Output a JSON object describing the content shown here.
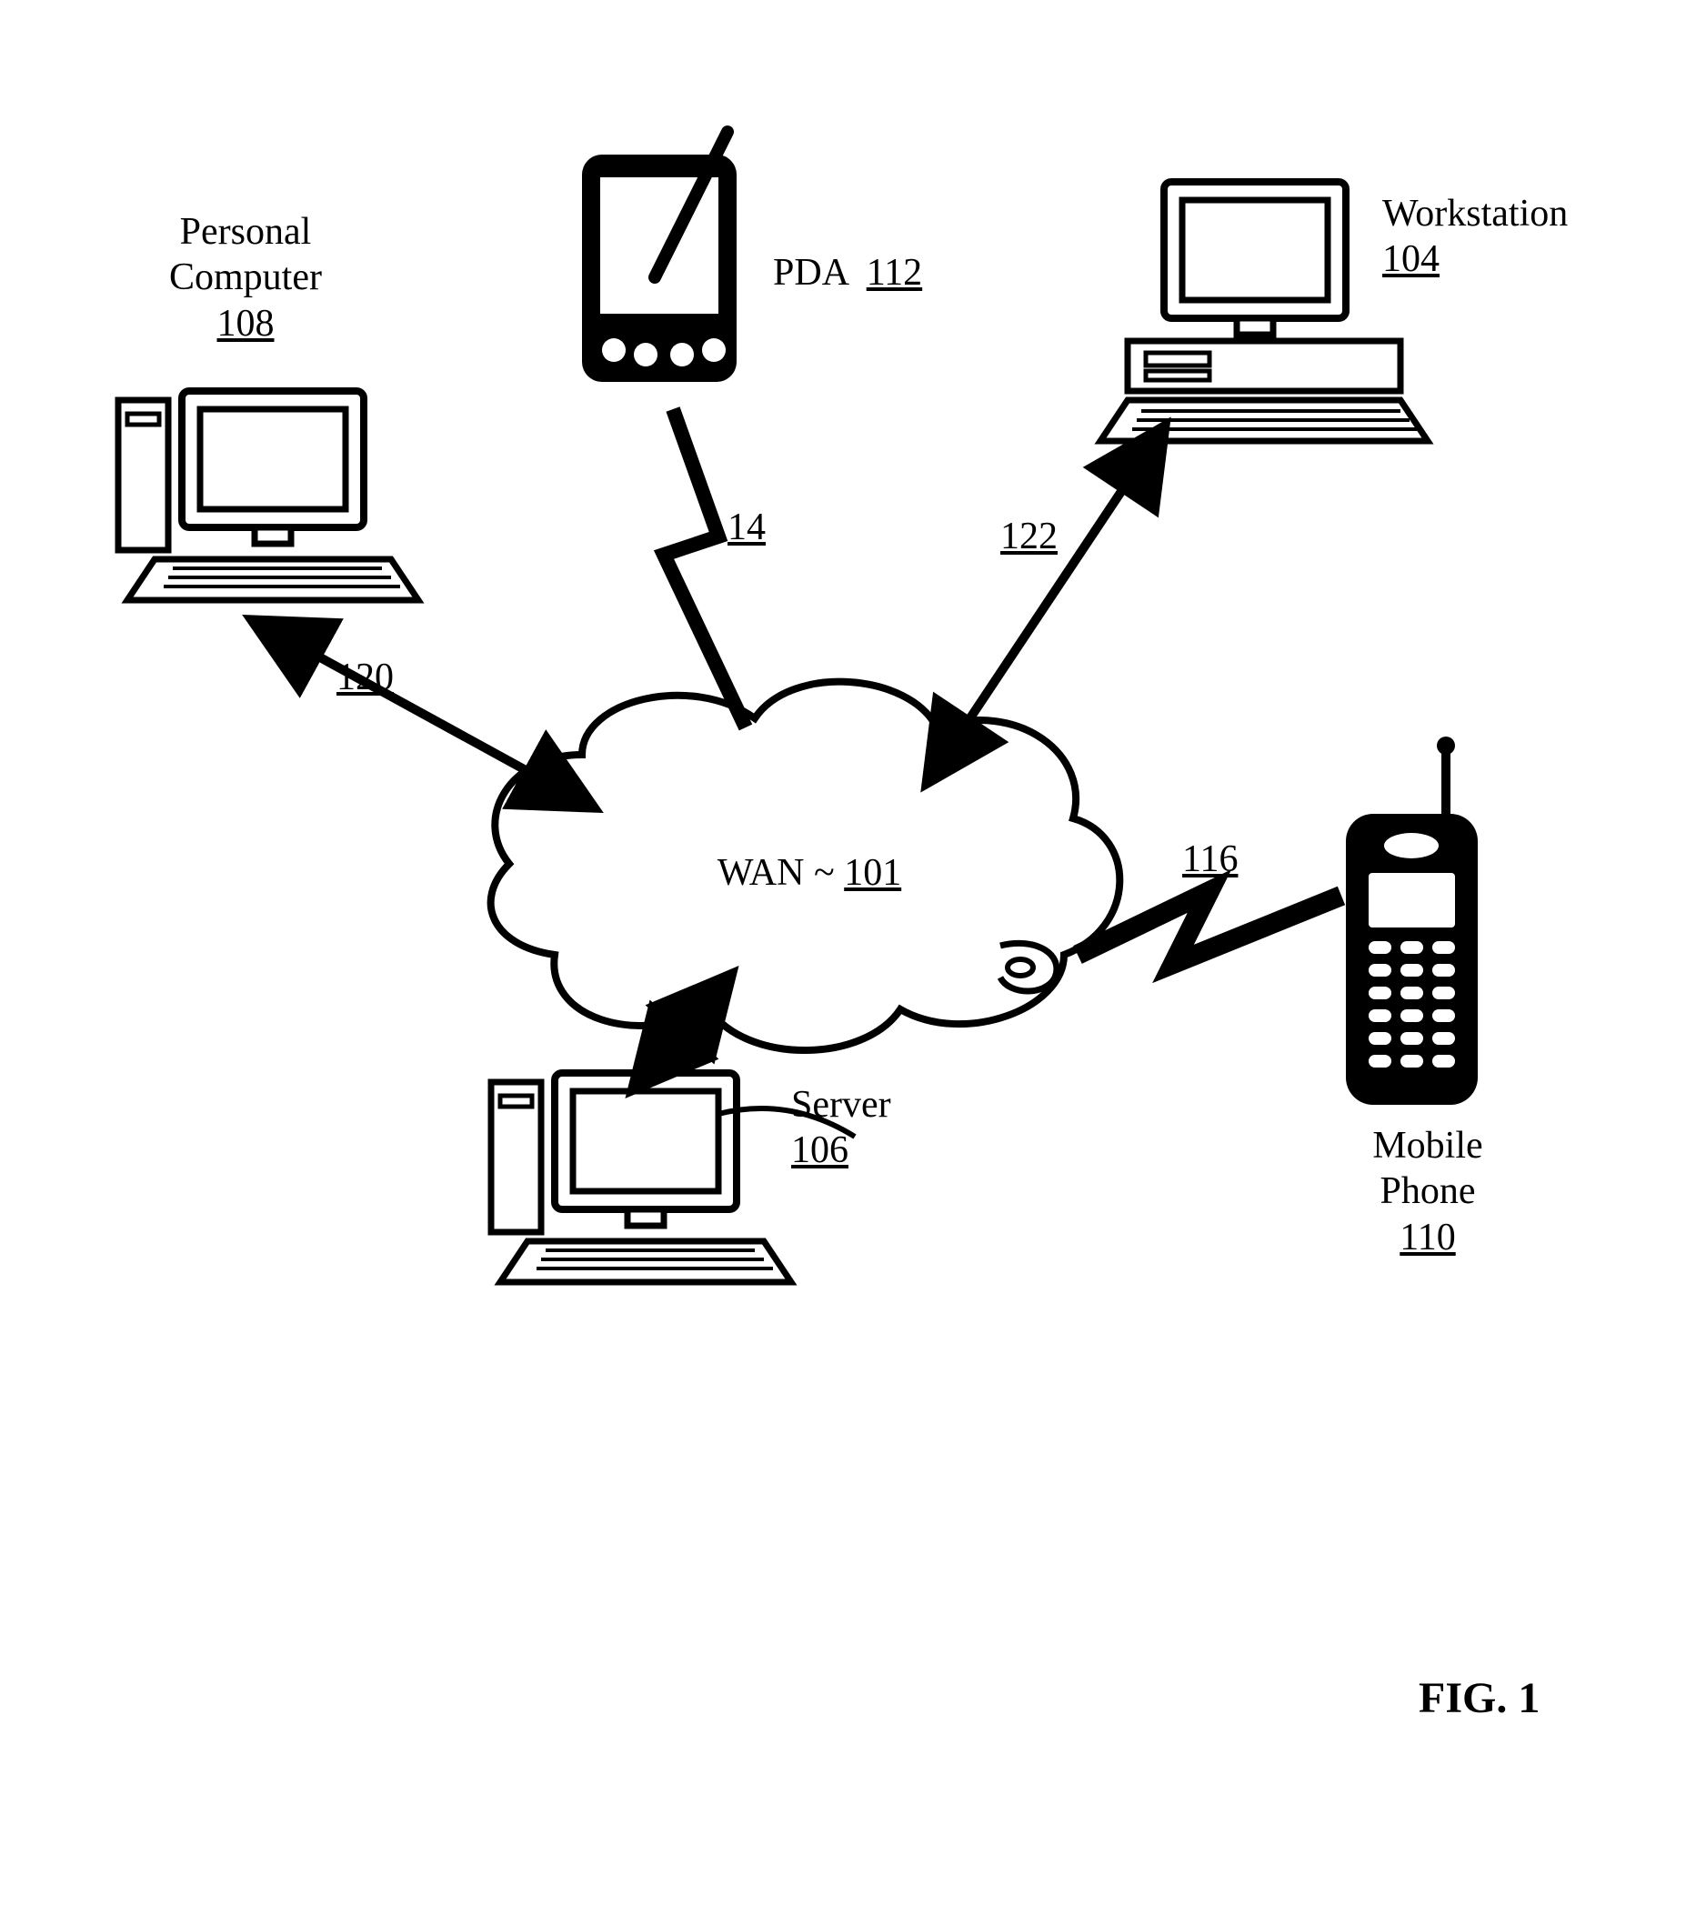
{
  "nodes": {
    "pc": {
      "label_line1": "Personal",
      "label_line2": "Computer",
      "ref": "108"
    },
    "pda": {
      "label": "PDA",
      "ref": "112"
    },
    "workstation": {
      "label": "Workstation",
      "ref": "104"
    },
    "wan": {
      "label_prefix": "WAN ~ ",
      "ref": "101"
    },
    "server": {
      "label": "Server",
      "ref": "106"
    },
    "mobile": {
      "label_line1": "Mobile",
      "label_line2": "Phone",
      "ref": "110"
    }
  },
  "links": {
    "pc_wan": {
      "ref": "120"
    },
    "pda_wan": {
      "ref": "14"
    },
    "workstation_wan": {
      "ref": "122"
    },
    "mobile_wan": {
      "ref": "116"
    }
  },
  "figure": {
    "label": "FIG. 1"
  }
}
